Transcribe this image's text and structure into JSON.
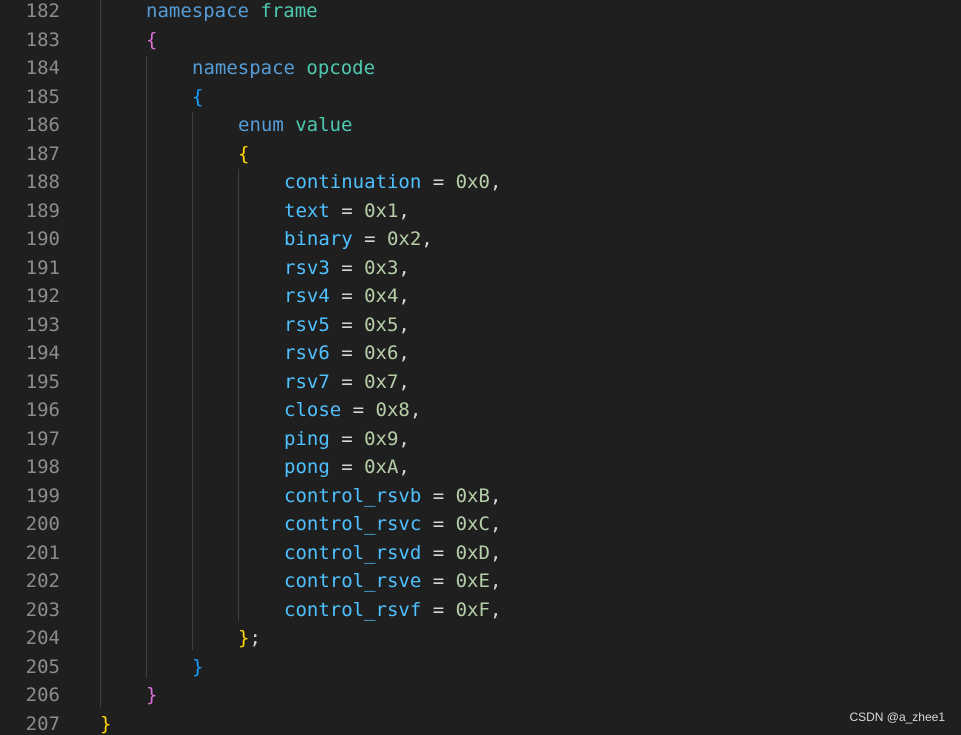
{
  "editor": {
    "lines": [
      {
        "number": "182",
        "tokens": [
          {
            "t": "namespace",
            "c": "kw"
          },
          {
            "t": " ",
            "c": "op"
          },
          {
            "t": "frame",
            "c": "ns"
          }
        ]
      },
      {
        "number": "183",
        "tokens": [
          {
            "t": "{",
            "c": "b2"
          }
        ]
      },
      {
        "number": "184",
        "tokens": [
          {
            "t": "namespace",
            "c": "kw"
          },
          {
            "t": " ",
            "c": "op"
          },
          {
            "t": "opcode",
            "c": "ns"
          }
        ]
      },
      {
        "number": "185",
        "tokens": [
          {
            "t": "{",
            "c": "b3"
          }
        ]
      },
      {
        "number": "186",
        "tokens": [
          {
            "t": "enum",
            "c": "kw"
          },
          {
            "t": " ",
            "c": "op"
          },
          {
            "t": "value",
            "c": "ns"
          }
        ]
      },
      {
        "number": "187",
        "tokens": [
          {
            "t": "{",
            "c": "b1"
          }
        ]
      },
      {
        "number": "188",
        "tokens": [
          {
            "t": "continuation",
            "c": "id"
          },
          {
            "t": " = ",
            "c": "op"
          },
          {
            "t": "0x0",
            "c": "num"
          },
          {
            "t": ",",
            "c": "op"
          }
        ]
      },
      {
        "number": "189",
        "tokens": [
          {
            "t": "text",
            "c": "id"
          },
          {
            "t": " = ",
            "c": "op"
          },
          {
            "t": "0x1",
            "c": "num"
          },
          {
            "t": ",",
            "c": "op"
          }
        ]
      },
      {
        "number": "190",
        "tokens": [
          {
            "t": "binary",
            "c": "id"
          },
          {
            "t": " = ",
            "c": "op"
          },
          {
            "t": "0x2",
            "c": "num"
          },
          {
            "t": ",",
            "c": "op"
          }
        ]
      },
      {
        "number": "191",
        "tokens": [
          {
            "t": "rsv3",
            "c": "id"
          },
          {
            "t": " = ",
            "c": "op"
          },
          {
            "t": "0x3",
            "c": "num"
          },
          {
            "t": ",",
            "c": "op"
          }
        ]
      },
      {
        "number": "192",
        "tokens": [
          {
            "t": "rsv4",
            "c": "id"
          },
          {
            "t": " = ",
            "c": "op"
          },
          {
            "t": "0x4",
            "c": "num"
          },
          {
            "t": ",",
            "c": "op"
          }
        ]
      },
      {
        "number": "193",
        "tokens": [
          {
            "t": "rsv5",
            "c": "id"
          },
          {
            "t": " = ",
            "c": "op"
          },
          {
            "t": "0x5",
            "c": "num"
          },
          {
            "t": ",",
            "c": "op"
          }
        ]
      },
      {
        "number": "194",
        "tokens": [
          {
            "t": "rsv6",
            "c": "id"
          },
          {
            "t": " = ",
            "c": "op"
          },
          {
            "t": "0x6",
            "c": "num"
          },
          {
            "t": ",",
            "c": "op"
          }
        ]
      },
      {
        "number": "195",
        "tokens": [
          {
            "t": "rsv7",
            "c": "id"
          },
          {
            "t": " = ",
            "c": "op"
          },
          {
            "t": "0x7",
            "c": "num"
          },
          {
            "t": ",",
            "c": "op"
          }
        ]
      },
      {
        "number": "196",
        "tokens": [
          {
            "t": "close",
            "c": "id"
          },
          {
            "t": " = ",
            "c": "op"
          },
          {
            "t": "0x8",
            "c": "num"
          },
          {
            "t": ",",
            "c": "op"
          }
        ]
      },
      {
        "number": "197",
        "tokens": [
          {
            "t": "ping",
            "c": "id"
          },
          {
            "t": " = ",
            "c": "op"
          },
          {
            "t": "0x9",
            "c": "num"
          },
          {
            "t": ",",
            "c": "op"
          }
        ]
      },
      {
        "number": "198",
        "tokens": [
          {
            "t": "pong",
            "c": "id"
          },
          {
            "t": " = ",
            "c": "op"
          },
          {
            "t": "0xA",
            "c": "num"
          },
          {
            "t": ",",
            "c": "op"
          }
        ]
      },
      {
        "number": "199",
        "tokens": [
          {
            "t": "control_rsvb",
            "c": "id"
          },
          {
            "t": " = ",
            "c": "op"
          },
          {
            "t": "0xB",
            "c": "num"
          },
          {
            "t": ",",
            "c": "op"
          }
        ]
      },
      {
        "number": "200",
        "tokens": [
          {
            "t": "control_rsvc",
            "c": "id"
          },
          {
            "t": " = ",
            "c": "op"
          },
          {
            "t": "0xC",
            "c": "num"
          },
          {
            "t": ",",
            "c": "op"
          }
        ]
      },
      {
        "number": "201",
        "tokens": [
          {
            "t": "control_rsvd",
            "c": "id"
          },
          {
            "t": " = ",
            "c": "op"
          },
          {
            "t": "0xD",
            "c": "num"
          },
          {
            "t": ",",
            "c": "op"
          }
        ]
      },
      {
        "number": "202",
        "tokens": [
          {
            "t": "control_rsve",
            "c": "id"
          },
          {
            "t": " = ",
            "c": "op"
          },
          {
            "t": "0xE",
            "c": "num"
          },
          {
            "t": ",",
            "c": "op"
          }
        ]
      },
      {
        "number": "203",
        "tokens": [
          {
            "t": "control_rsvf",
            "c": "id"
          },
          {
            "t": " = ",
            "c": "op"
          },
          {
            "t": "0xF",
            "c": "num"
          },
          {
            "t": ",",
            "c": "op"
          }
        ]
      },
      {
        "number": "204",
        "tokens": [
          {
            "t": "}",
            "c": "b1"
          },
          {
            "t": ";",
            "c": "op"
          }
        ]
      },
      {
        "number": "205",
        "tokens": [
          {
            "t": "}",
            "c": "b3"
          }
        ]
      },
      {
        "number": "206",
        "tokens": [
          {
            "t": "}",
            "c": "b2"
          }
        ]
      },
      {
        "number": "207",
        "tokens": [
          {
            "t": "}",
            "c": "b1"
          }
        ]
      }
    ]
  },
  "colors": {
    "background": "#1f1f1f",
    "line_number": "#8c8c8c",
    "keyword": "#569cd6",
    "namespace_name": "#4ec9b0",
    "identifier": "#4fc1ff",
    "number": "#b5cea8",
    "bracket_gold": "#ffd700",
    "bracket_orchid": "#da70d6",
    "bracket_blue": "#179fff"
  },
  "watermark": "CSDN @a_zhee1"
}
